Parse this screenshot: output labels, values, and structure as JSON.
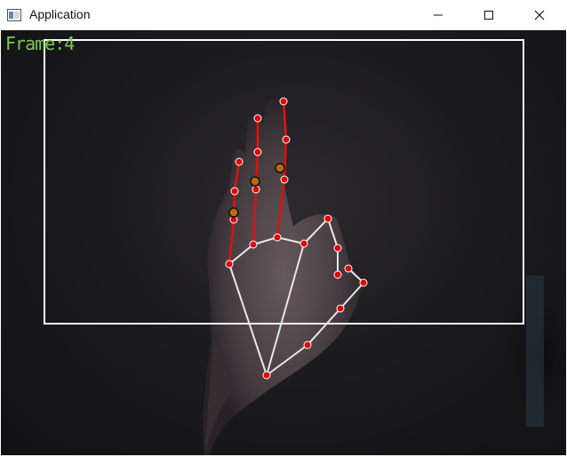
{
  "window": {
    "title": "Application",
    "controls": {
      "minimize": "minimize",
      "maximize": "maximize",
      "close": "close"
    }
  },
  "overlay": {
    "frame_label": "Frame:4"
  },
  "colors": {
    "bbox": "#ffffff",
    "landmark": "#e00000",
    "landmark_outline": "#ffffff",
    "bone_raised": "#e01010",
    "bone_other": "#e8e8e8",
    "highlight": "#b86a10",
    "frame_label": "#7ec850"
  }
}
